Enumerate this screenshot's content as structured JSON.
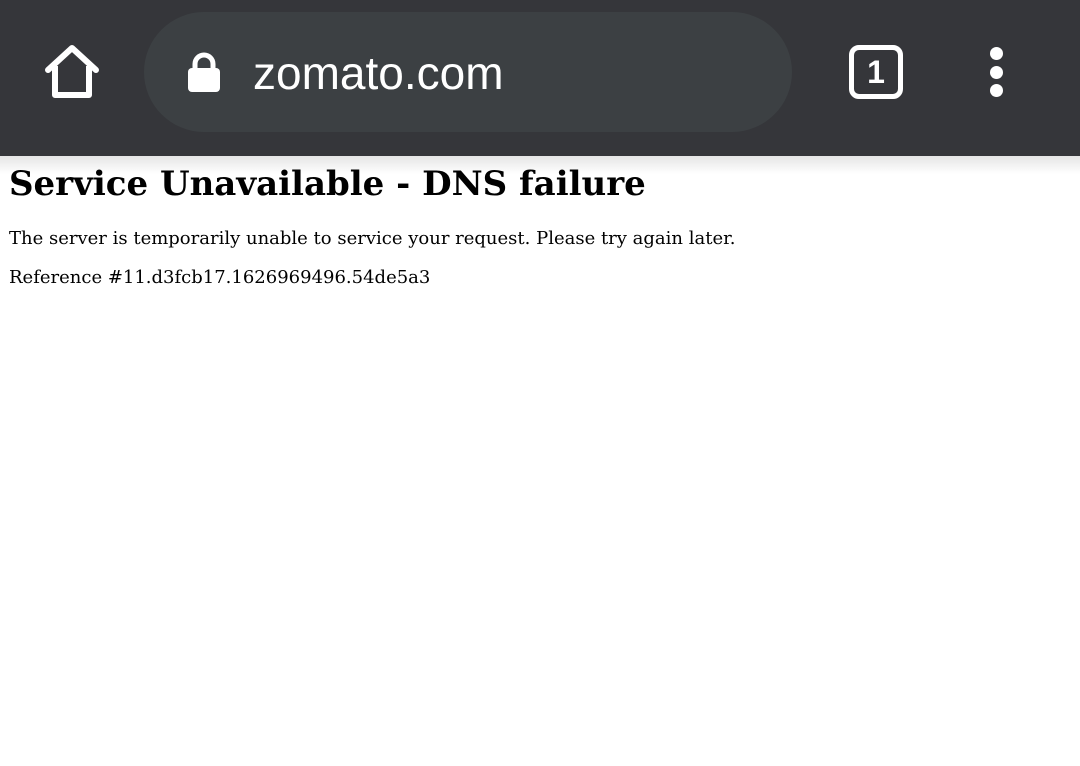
{
  "browser": {
    "url": "zomato.com",
    "tab_count": "1",
    "toolbar_color": "#35363a",
    "omnibox_color": "#3c4043",
    "icons": {
      "home": "home-icon",
      "lock": "lock-icon",
      "tabs": "tab-switcher-icon",
      "menu": "more-vert-icon"
    }
  },
  "page": {
    "title": "Service Unavailable - DNS failure",
    "message": "The server is temporarily unable to service your request. Please try again later.",
    "reference": "Reference #11.d3fcb17.1626969496.54de5a3"
  }
}
